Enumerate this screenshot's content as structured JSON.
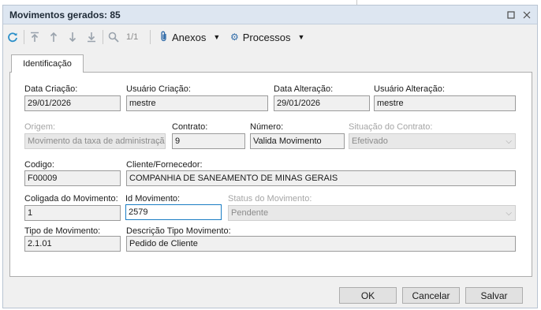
{
  "window": {
    "title": "Movimentos gerados: 85",
    "maximize_icon": "maximize-icon",
    "close_icon": "close-icon"
  },
  "toolbar": {
    "refresh_icon": "refresh-icon",
    "pager": "1/1",
    "anexos_label": "Anexos",
    "processos_label": "Processos"
  },
  "tabs": [
    {
      "label": "Identificação",
      "selected": true
    }
  ],
  "form": {
    "data_criacao": {
      "label": "Data Criação:",
      "value": "29/01/2026"
    },
    "usuario_criacao": {
      "label": "Usuário Criação:",
      "value": "mestre"
    },
    "data_alteracao": {
      "label": "Data Alteração:",
      "value": "29/01/2026"
    },
    "usuario_alteracao": {
      "label": "Usuário Alteração:",
      "value": "mestre"
    },
    "origem": {
      "label": "Origem:",
      "value": "Movimento da taxa de administração"
    },
    "contrato": {
      "label": "Contrato:",
      "value": "9"
    },
    "numero": {
      "label": "Número:",
      "value": "Valida Movimento"
    },
    "situacao_contrato": {
      "label": "Situação do Contrato:",
      "value": "Efetivado"
    },
    "codigo": {
      "label": "Codigo:",
      "value": "F00009"
    },
    "cliente_fornecedor": {
      "label": "Cliente/Fornecedor:",
      "value": "COMPANHIA DE SANEAMENTO DE MINAS GERAIS"
    },
    "coligada_movimento": {
      "label": "Coligada do Movimento:",
      "value": "1"
    },
    "id_movimento": {
      "label": "Id Movimento:",
      "value": "2579"
    },
    "status_movimento": {
      "label": "Status do Movimento:",
      "value": "Pendente"
    },
    "tipo_movimento": {
      "label": "Tipo de Movimento:",
      "value": "2.1.01"
    },
    "descricao_tipo_movimento": {
      "label": "Descrição Tipo Movimento:",
      "value": "Pedido de Cliente"
    }
  },
  "buttons": {
    "ok": "OK",
    "cancelar": "Cancelar",
    "salvar": "Salvar"
  },
  "colors": {
    "titlebar": "#dde6f1",
    "accent": "#2b8fc9",
    "focus_border": "#1a7dc4"
  }
}
